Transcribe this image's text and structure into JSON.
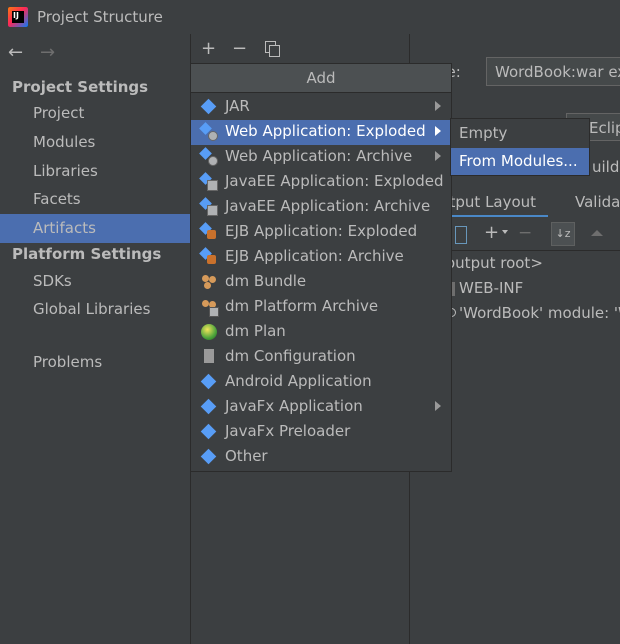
{
  "window": {
    "title": "Project Structure"
  },
  "nav": {
    "back": "←",
    "forward": "→"
  },
  "sidebar": {
    "project_settings": "Project Settings",
    "items1": [
      "Project",
      "Modules",
      "Libraries",
      "Facets",
      "Artifacts"
    ],
    "platform_settings": "Platform Settings",
    "items2": [
      "SDKs",
      "Global Libraries"
    ],
    "problems": "Problems",
    "selected": "Artifacts"
  },
  "toolbar": {
    "add": "+",
    "remove": "−"
  },
  "detail": {
    "name_label": "ne:",
    "name_value": "WordBook:war ex",
    "eclipse_partial": "Eclip",
    "build_partial": "uild",
    "tab_output_layout": "utput Layout",
    "tab_validation": "Valida",
    "tree_root": "output root>",
    "tree_webinf": "WEB-INF",
    "tree_module": "'WordBook' module: 'W"
  },
  "add_menu": {
    "header": "Add",
    "items": [
      {
        "label": "JAR",
        "icon": "jar-icon",
        "submenu": true
      },
      {
        "label": "Web Application: Exploded",
        "icon": "web-app-icon",
        "submenu": true,
        "selected": true
      },
      {
        "label": "Web Application: Archive",
        "icon": "web-app-icon",
        "submenu": true
      },
      {
        "label": "JavaEE Application: Exploded",
        "icon": "javaee-icon",
        "submenu": false
      },
      {
        "label": "JavaEE Application: Archive",
        "icon": "javaee-icon",
        "submenu": false
      },
      {
        "label": "EJB Application: Exploded",
        "icon": "ejb-icon",
        "submenu": false
      },
      {
        "label": "EJB Application: Archive",
        "icon": "ejb-icon",
        "submenu": false
      },
      {
        "label": "dm Bundle",
        "icon": "dm-bundle-icon",
        "submenu": false
      },
      {
        "label": "dm Platform Archive",
        "icon": "dm-archive-icon",
        "submenu": false
      },
      {
        "label": "dm Plan",
        "icon": "dm-plan-icon",
        "submenu": false
      },
      {
        "label": "dm Configuration",
        "icon": "dm-config-icon",
        "submenu": false
      },
      {
        "label": "Android Application",
        "icon": "android-icon",
        "submenu": false
      },
      {
        "label": "JavaFx Application",
        "icon": "javafx-icon",
        "submenu": true
      },
      {
        "label": "JavaFx Preloader",
        "icon": "javafx-icon",
        "submenu": false
      },
      {
        "label": "Other",
        "icon": "other-icon",
        "submenu": false
      }
    ]
  },
  "submenu": {
    "items": [
      "Empty",
      "From Modules..."
    ],
    "selected": "From Modules..."
  }
}
